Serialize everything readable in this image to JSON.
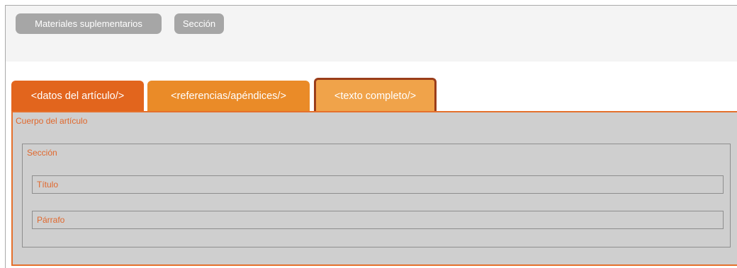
{
  "toolbar": {
    "buttons": [
      {
        "label": "Materiales suplementarios"
      },
      {
        "label": "Sección"
      }
    ]
  },
  "tabs": [
    {
      "label": "<datos del artículo/>",
      "color": "#e2651d"
    },
    {
      "label": "<referencias/apéndices/>",
      "color": "#ea8b28"
    },
    {
      "label": "<texto completo/>",
      "color": "#f0a34a",
      "active": true
    }
  ],
  "panel": {
    "label": "Cuerpo del artículo",
    "section": {
      "label": "Sección",
      "fields": [
        {
          "label": "Título"
        },
        {
          "label": "Párrafo"
        }
      ]
    }
  },
  "colors": {
    "accent": "#e0682d",
    "active_tab_border": "#9a3d1a",
    "panel_bg": "#cfcfcf",
    "pill_bg": "#a6a6a6"
  }
}
